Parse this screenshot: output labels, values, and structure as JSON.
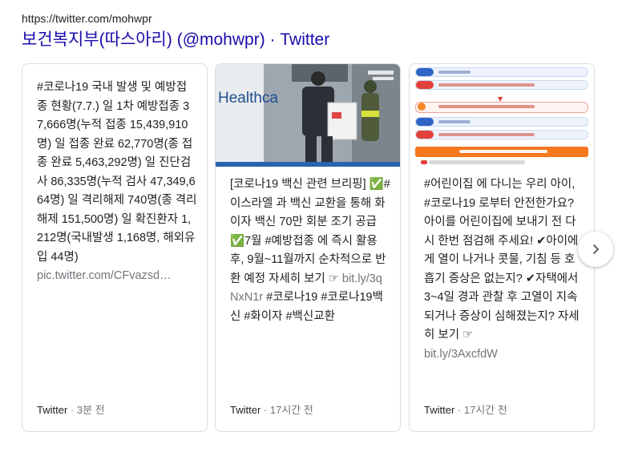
{
  "result": {
    "url": "https://twitter.com/mohwpr",
    "title": "보건복지부(따스아리) (@mohwpr) · Twitter"
  },
  "cards": [
    {
      "text": "#코로나19 국내 발생 및 예방접종 현황(7.7.) 일 1차 예방접종 37,666명(누적 접종 15,439,910명) 일 접종 완료 62,770명(종 접종 완료 5,463,292명) 일 진단검사 86,335명(누적 검사 47,349,664명) 일 격리해제 740명(종 격리해제 151,500명) 일 확진환자 1,212명(국내발생 1,168명, 해외유입 44명)",
      "link": "pic.twitter.com/CFvazsd…",
      "source": "Twitter",
      "time": "3분 전"
    },
    {
      "image_caption": "Healthca",
      "text": "[코로나19 백신 관련 브리핑] ✅#이스라엘 과 백신 교환을 통해 화이자 백신 70만 회분 조기 공급 ✅7월 #예방접종 에 즉시 활용 후, 9월~11월까지 순차적으로 반환 예정 자세히 보기 ☞",
      "link": "bit.ly/3qNxN1r",
      "text2": "#코로나19 #코로나19백신 #화이자 #백신교환",
      "source": "Twitter",
      "time": "17시간 전"
    },
    {
      "text": "#어린이집 에 다니는 우리 아이, #코로나19 로부터 안전한가요? 아이를 어린이집에 보내기 전 다시 한번 점검해 주세요! ✔아이에게 열이 나거나 콧물, 기침 등 호흡기 증상은 없는지? ✔자택에서 3~4일 경과 관찰 후 고열이 지속되거나 증상이 심해졌는지? 자세히 보기 ☞",
      "link": "bit.ly/3AxcfdW",
      "source": "Twitter",
      "time": "17시간 전"
    }
  ],
  "colors": {
    "title_link": "#1a0dab",
    "muted": "#70757a",
    "border": "#dadce0"
  },
  "icons": {
    "next": "chevron-right-icon"
  }
}
